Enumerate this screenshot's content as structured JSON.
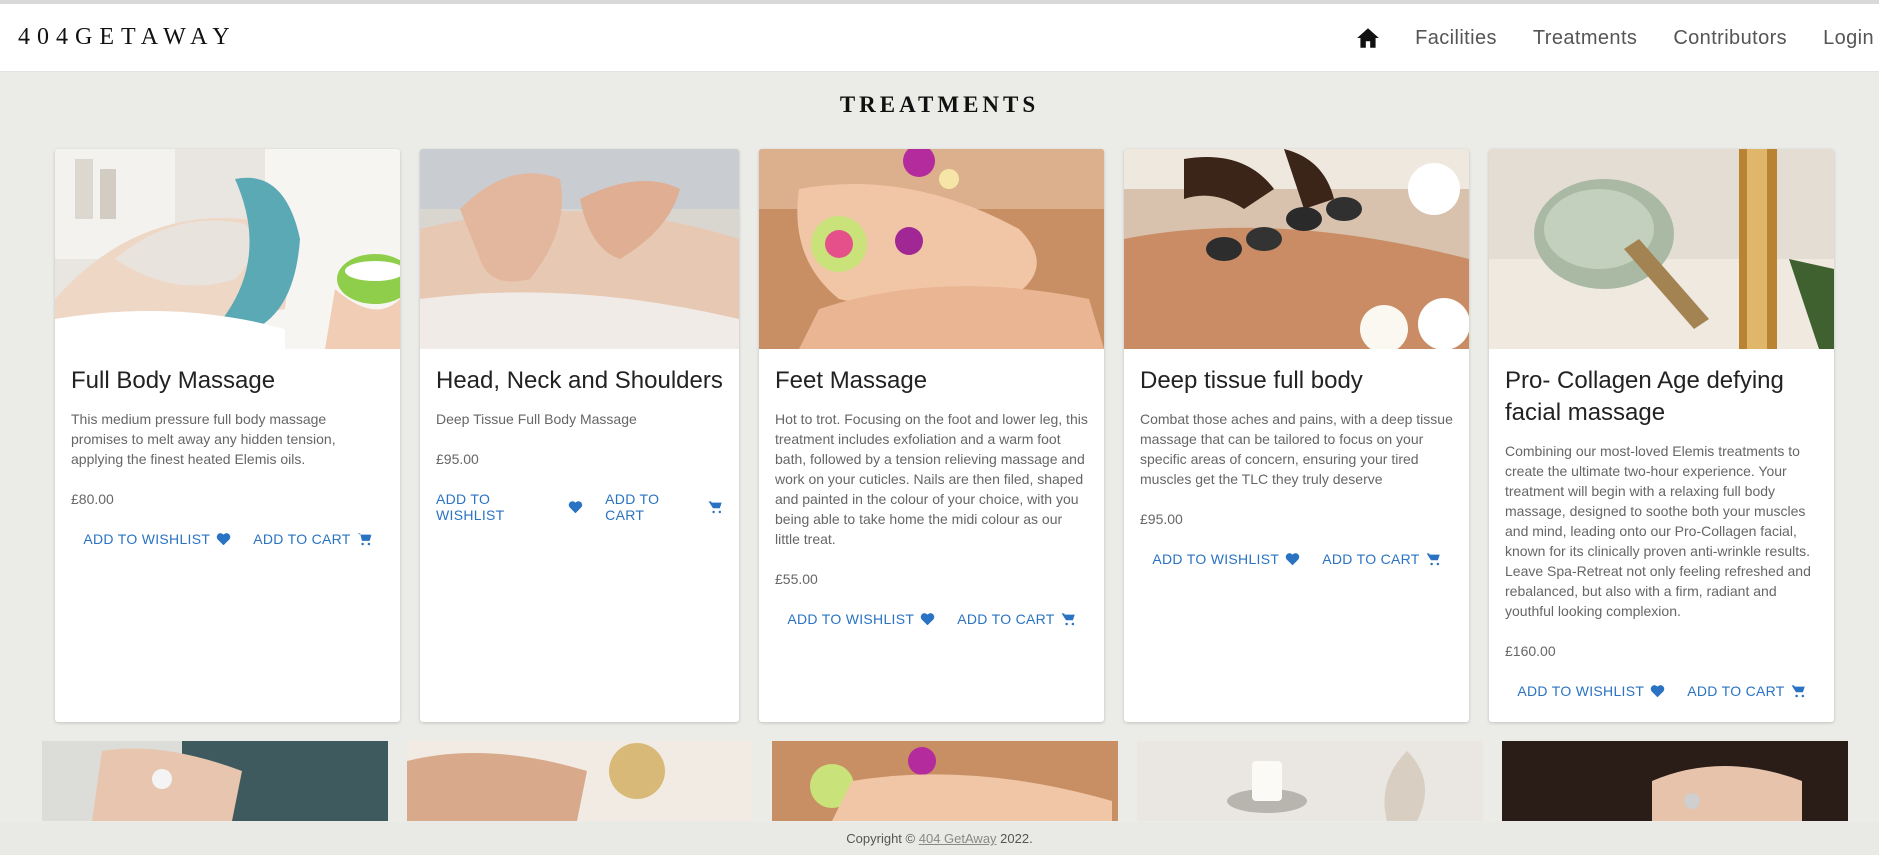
{
  "header": {
    "brand": "404GETAWAY",
    "nav": [
      "Facilities",
      "Treatments",
      "Contributors",
      "Login"
    ]
  },
  "page_title": "TREATMENTS",
  "cards": [
    {
      "title": "Full Body Massage",
      "description": "This medium pressure full body massage promises to melt away any hidden tension, applying the finest heated Elemis oils.",
      "price": "£80.00",
      "wishlist_label": "ADD TO WISHLIST",
      "cart_label": "ADD TO CART"
    },
    {
      "title": "Head, Neck and Shoulders",
      "description": "Deep Tissue Full Body Massage",
      "price": "£95.00",
      "wishlist_label": "ADD TO WISHLIST",
      "cart_label": "ADD TO CART"
    },
    {
      "title": "Feet Massage",
      "description": "Hot to trot. Focusing on the foot and lower leg, this treatment includes exfoliation and a warm foot bath, followed by a tension relieving massage and work on your cuticles. Nails are then filed, shaped and painted in the colour of your choice, with you being able to take home the midi colour as our little treat.",
      "price": "£55.00",
      "wishlist_label": "ADD TO WISHLIST",
      "cart_label": "ADD TO CART"
    },
    {
      "title": "Deep tissue full body",
      "description": "Combat those aches and pains, with a deep tissue massage that can be tailored to focus on your specific areas of concern, ensuring your tired muscles get the TLC they truly deserve",
      "price": "£95.00",
      "wishlist_label": "ADD TO WISHLIST",
      "cart_label": "ADD TO CART"
    },
    {
      "title": "Pro- Collagen Age defying facial massage",
      "description": "Combining our most-loved Elemis treatments to create the ultimate two-hour experience. Your treatment will begin with a relaxing full body massage, designed to soothe both your muscles and mind, leading onto our Pro-Collagen facial, known for its clinically proven anti-wrinkle results. Leave Spa-Retreat not only feeling refreshed and rebalanced, but also with a firm, radiant and youthful looking complexion.",
      "price": "£160.00",
      "wishlist_label": "ADD TO WISHLIST",
      "cart_label": "ADD TO CART"
    }
  ],
  "footer": {
    "prefix": "Copyright ©",
    "link": "404 GetAway",
    "year": "2022."
  },
  "colors": {
    "link": "#2a73c2",
    "background": "#ebebe8"
  }
}
